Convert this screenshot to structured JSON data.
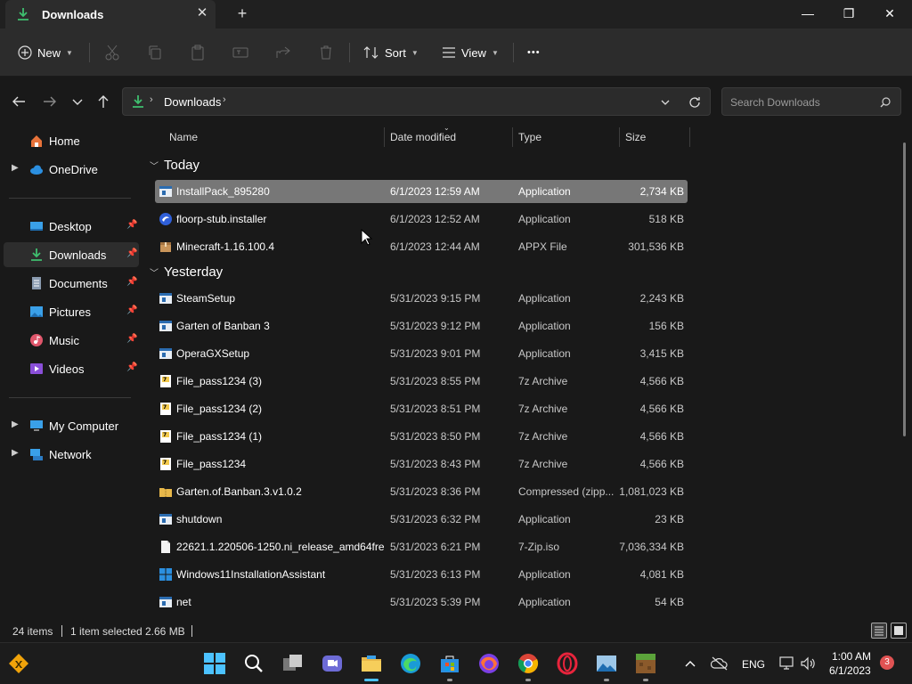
{
  "window": {
    "tab_title": "Downloads",
    "tab_close": "✕",
    "new_tab": "+",
    "minimize": "—",
    "maximize": "❐",
    "close": "✕"
  },
  "toolbar": {
    "new_label": "New",
    "sort_label": "Sort",
    "view_label": "View",
    "more_label": "•••"
  },
  "address": {
    "path": "Downloads",
    "search_placeholder": "Search Downloads"
  },
  "sidebar": {
    "items": [
      {
        "label": "Home",
        "icon": "home-icon"
      },
      {
        "label": "OneDrive",
        "icon": "onedrive-icon"
      },
      {
        "label": "Desktop",
        "icon": "desktop-icon"
      },
      {
        "label": "Downloads",
        "icon": "download-icon"
      },
      {
        "label": "Documents",
        "icon": "documents-icon"
      },
      {
        "label": "Pictures",
        "icon": "pictures-icon"
      },
      {
        "label": "Music",
        "icon": "music-icon"
      },
      {
        "label": "Videos",
        "icon": "videos-icon"
      },
      {
        "label": "My Computer",
        "icon": "computer-icon"
      },
      {
        "label": "Network",
        "icon": "network-icon"
      }
    ]
  },
  "columns": {
    "name": "Name",
    "date": "Date modified",
    "type": "Type",
    "size": "Size"
  },
  "groups": {
    "today": "Today",
    "yesterday": "Yesterday"
  },
  "files": [
    {
      "name": "InstallPack_895280",
      "date": "6/1/2023 12:59 AM",
      "type": "Application",
      "size": "2,734 KB",
      "icon": "app"
    },
    {
      "name": "floorp-stub.installer",
      "date": "6/1/2023 12:52 AM",
      "type": "Application",
      "size": "518 KB",
      "icon": "floorp"
    },
    {
      "name": "Minecraft-1.16.100.4",
      "date": "6/1/2023 12:44 AM",
      "type": "APPX File",
      "size": "301,536 KB",
      "icon": "package"
    },
    {
      "name": "SteamSetup",
      "date": "5/31/2023 9:15 PM",
      "type": "Application",
      "size": "2,243 KB",
      "icon": "app"
    },
    {
      "name": "Garten of Banban 3",
      "date": "5/31/2023 9:12 PM",
      "type": "Application",
      "size": "156 KB",
      "icon": "app"
    },
    {
      "name": "OperaGXSetup",
      "date": "5/31/2023 9:01 PM",
      "type": "Application",
      "size": "3,415 KB",
      "icon": "app"
    },
    {
      "name": "File_pass1234 (3)",
      "date": "5/31/2023 8:55 PM",
      "type": "7z Archive",
      "size": "4,566 KB",
      "icon": "7z"
    },
    {
      "name": "File_pass1234 (2)",
      "date": "5/31/2023 8:51 PM",
      "type": "7z Archive",
      "size": "4,566 KB",
      "icon": "7z"
    },
    {
      "name": "File_pass1234 (1)",
      "date": "5/31/2023 8:50 PM",
      "type": "7z Archive",
      "size": "4,566 KB",
      "icon": "7z"
    },
    {
      "name": "File_pass1234",
      "date": "5/31/2023 8:43 PM",
      "type": "7z Archive",
      "size": "4,566 KB",
      "icon": "7z"
    },
    {
      "name": "Garten.of.Banban.3.v1.0.2",
      "date": "5/31/2023 8:36 PM",
      "type": "Compressed (zipp...",
      "size": "1,081,023 KB",
      "icon": "zip"
    },
    {
      "name": "shutdown",
      "date": "5/31/2023 6:32 PM",
      "type": "Application",
      "size": "23 KB",
      "icon": "app"
    },
    {
      "name": "22621.1.220506-1250.ni_release_amd64fre...",
      "date": "5/31/2023 6:21 PM",
      "type": "7-Zip.iso",
      "size": "7,036,334 KB",
      "icon": "file"
    },
    {
      "name": "Windows11InstallationAssistant",
      "date": "5/31/2023 6:13 PM",
      "type": "Application",
      "size": "4,081 KB",
      "icon": "windows"
    },
    {
      "name": "net",
      "date": "5/31/2023 5:39 PM",
      "type": "Application",
      "size": "54 KB",
      "icon": "app"
    }
  ],
  "status": {
    "items": "24 items",
    "selected": "1 item selected",
    "size": "2.66 MB"
  },
  "taskbar": {
    "language": "ENG",
    "time": "1:00 AM",
    "date": "6/1/2023",
    "notifications": "3"
  },
  "colors": {
    "accent": "#4cc2ff",
    "download_green": "#3fbf6f",
    "selection": "#777777",
    "folder_yellow": "#e8b84a"
  }
}
